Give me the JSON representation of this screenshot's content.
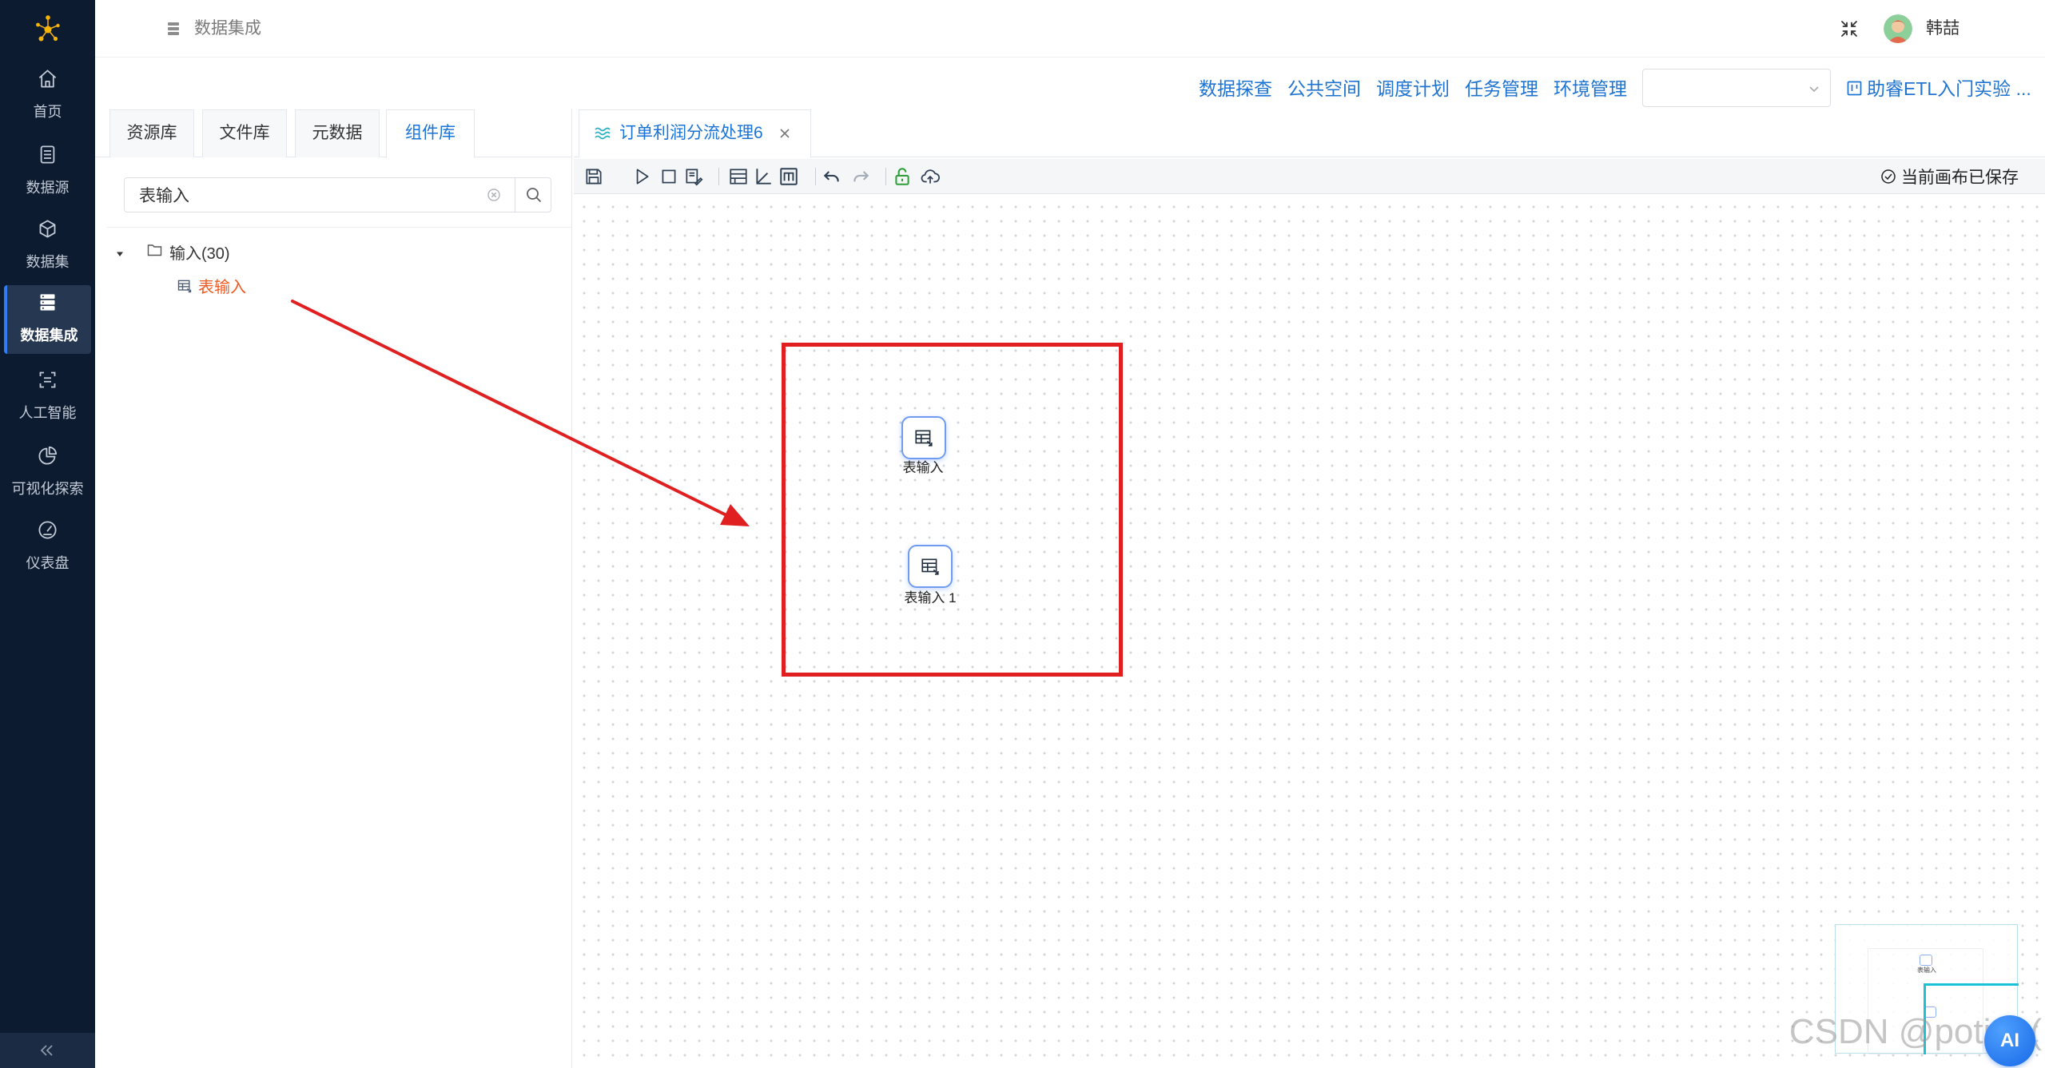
{
  "logo": {
    "icon": "molecule-logo-icon"
  },
  "sidebar": {
    "items": [
      {
        "label": "首页",
        "icon": "home-icon"
      },
      {
        "label": "数据源",
        "icon": "datasource-icon"
      },
      {
        "label": "数据集",
        "icon": "cube-icon"
      },
      {
        "label": "数据集成",
        "icon": "data-integration-icon",
        "active": true
      },
      {
        "label": "人工智能",
        "icon": "ai-scan-icon"
      },
      {
        "label": "可视化探索",
        "icon": "pie-chart-icon"
      },
      {
        "label": "仪表盘",
        "icon": "gauge-icon"
      }
    ],
    "collapse_icon": "double-chevron-left-icon"
  },
  "header": {
    "breadcrumb_icon": "stack-icon",
    "breadcrumb": "数据集成",
    "fullscreen_icon": "exit-fullscreen-icon",
    "user_name": "韩喆"
  },
  "top_nav": {
    "links": [
      "数据探查",
      "公共空间",
      "调度计划",
      "任务管理",
      "环境管理"
    ],
    "environment_select_icon": "chevron-down-icon",
    "guide_icon": "board-icon",
    "guide_link": "助睿ETL入门实验 ..."
  },
  "left_panel": {
    "tabs": [
      "资源库",
      "文件库",
      "元数据",
      "组件库"
    ],
    "active_tab_index": 3,
    "search": {
      "value": "表输入",
      "clear_icon": "clear-circle-icon",
      "button_icon": "search-icon"
    },
    "tree": {
      "folder_label": "输入(30)",
      "expanded": true,
      "folder_icon": "folder-icon",
      "children": [
        {
          "label": "表输入",
          "icon": "table-input-icon",
          "highlighted": true
        }
      ]
    }
  },
  "canvas": {
    "tab_title": "订单利润分流处理6",
    "tab_icon": "flow-wave-icon",
    "toolbar_icons": [
      "save-icon",
      "run-icon",
      "stop-icon",
      "debug-icon",
      "layout-icon",
      "align-icon",
      "grid-m-icon",
      "undo-icon",
      "redo-icon",
      "unlock-icon",
      "cloud-upload-icon"
    ],
    "save_status": "当前画布已保存",
    "nodes": [
      {
        "label": "表输入",
        "icon": "table-input-icon"
      },
      {
        "label": "表输入 1",
        "icon": "table-input-icon"
      }
    ],
    "minimap": {
      "node_labels": [
        "表输入"
      ]
    }
  },
  "colors": {
    "sidebar_bg": "#0d1b31",
    "sidebar_active_bg": "#263751",
    "accent": "#1a73d6",
    "link": "#1f74d1",
    "tree_highlight": "#f05a22",
    "annotation": "#e02020",
    "minimap_viewport": "#19c2d6",
    "node_border": "#6f9cf0"
  },
  "watermark": "CSDN @potion(",
  "ai_button": "AI"
}
